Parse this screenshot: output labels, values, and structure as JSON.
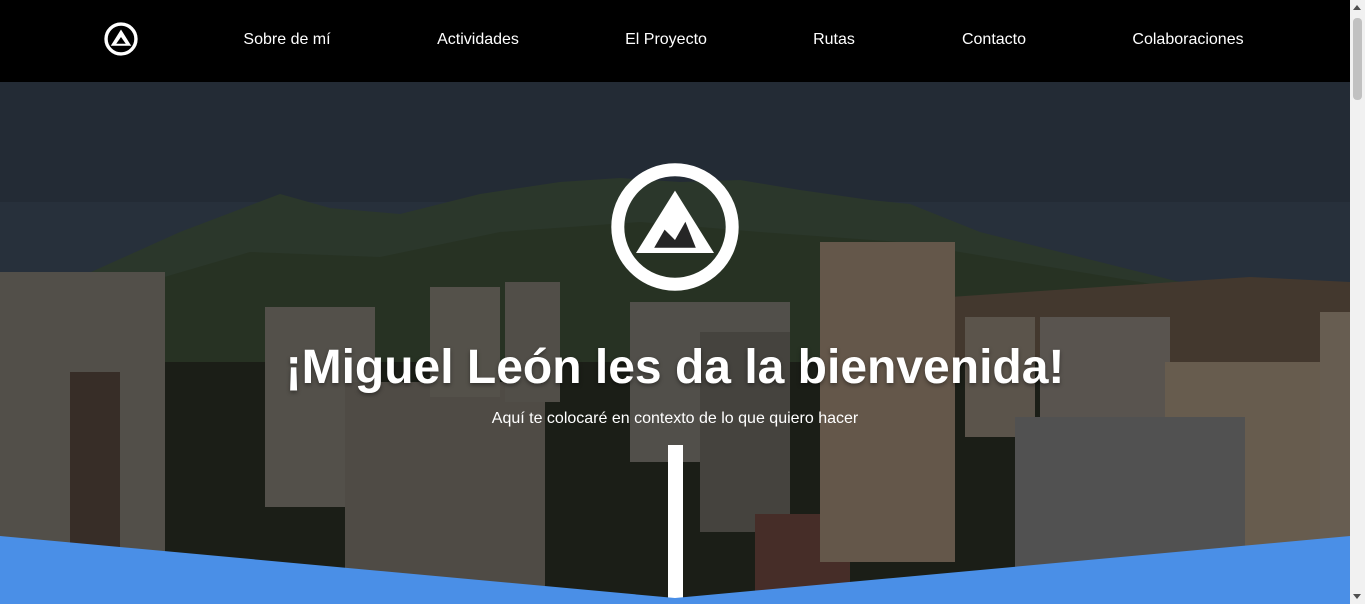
{
  "nav": {
    "logo_icon": "mountain-logo-icon",
    "links": [
      {
        "label": "Sobre de mí"
      },
      {
        "label": "Actividades"
      },
      {
        "label": "El Proyecto"
      },
      {
        "label": "Rutas"
      },
      {
        "label": "Contacto"
      },
      {
        "label": "Colaboraciones"
      }
    ]
  },
  "hero": {
    "logo_icon": "mountain-logo-icon",
    "title": "¡Miguel León les da la bienvenida!",
    "subtitle": "Aquí te colocaré en contexto de lo que quiero hacer"
  },
  "colors": {
    "nav_background": "#000000",
    "accent_blue": "#4a8fe7",
    "text": "#ffffff"
  }
}
